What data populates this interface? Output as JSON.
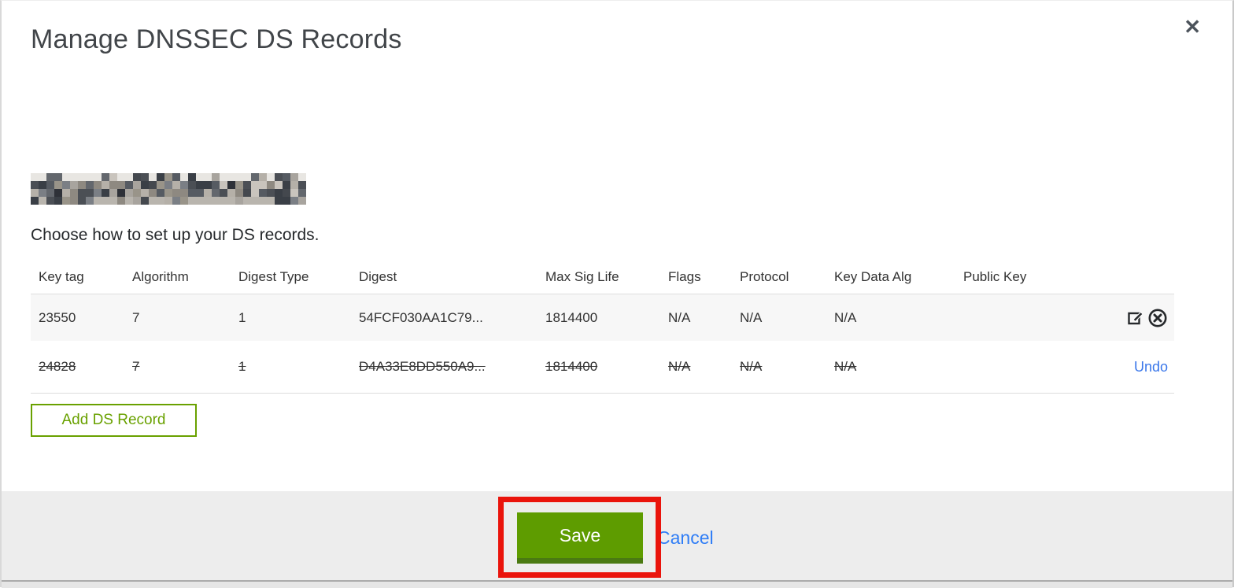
{
  "modal": {
    "title": "Manage DNSSEC DS Records",
    "close_icon": "✕"
  },
  "domain_display": {
    "redacted": true,
    "note": "domain name pixelated/redacted"
  },
  "instruction": "Choose how to set up your DS records.",
  "table": {
    "columns": [
      "Key tag",
      "Algorithm",
      "Digest Type",
      "Digest",
      "Max Sig Life",
      "Flags",
      "Protocol",
      "Key Data Alg",
      "Public Key"
    ],
    "rows": [
      {
        "key_tag": "23550",
        "algorithm": "7",
        "digest_type": "1",
        "digest": "54FCF030AA1C79...",
        "max_sig_life": "1814400",
        "flags": "N/A",
        "protocol": "N/A",
        "key_data_alg": "N/A",
        "public_key": "",
        "state": "active"
      },
      {
        "key_tag": "24828",
        "algorithm": "7",
        "digest_type": "1",
        "digest": "D4A33E8DD550A9...",
        "max_sig_life": "1814400",
        "flags": "N/A",
        "protocol": "N/A",
        "key_data_alg": "N/A",
        "public_key": "",
        "state": "marked-for-deletion",
        "undo_label": "Undo"
      }
    ]
  },
  "actions": {
    "add_ds_record": "Add DS Record",
    "save": "Save",
    "cancel": "Cancel"
  },
  "colors": {
    "accent_green": "#69a100",
    "save_green": "#5e9c00",
    "save_green_dark": "#4a7a12",
    "link_blue": "#2f7df6",
    "annotation_red": "#ea140c",
    "row_stripe": "#f7f7f7",
    "footer_gray": "#ededed"
  }
}
